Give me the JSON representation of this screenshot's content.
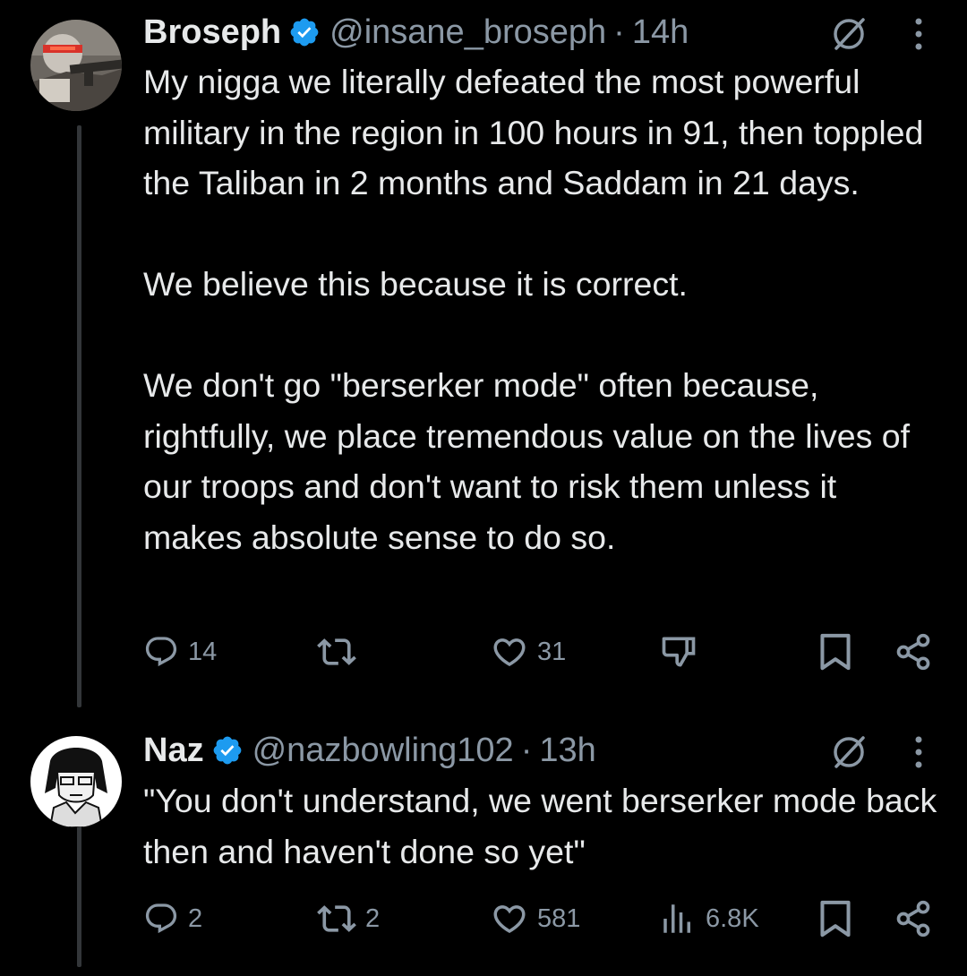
{
  "tweets": [
    {
      "author_name": "Broseph",
      "handle": "@insane_broseph",
      "separator": "·",
      "time": "14h",
      "paragraphs": [
        "My nigga we literally defeated the most powerful military in the region in 100 hours in 91, then toppled the Taliban in 2 months and Saddam in 21 days.",
        "We believe this because it is correct.",
        "We don't go \"berserker mode\" often because, rightfully, we place tremendous value on the lives of our troops and don't want to risk them unless it makes absolute sense to do so."
      ],
      "replies": "14",
      "reposts": "",
      "likes": "31"
    },
    {
      "author_name": "Naz",
      "handle": "@nazbowling102",
      "separator": "·",
      "time": "13h",
      "paragraphs": [
        "\"You don't understand, we went berserker mode back then and haven't done so yet\""
      ],
      "replies": "2",
      "reposts": "2",
      "likes": "581",
      "views": "6.8K"
    }
  ],
  "icons": {
    "verified": "verified-badge-icon",
    "grok": "grok-icon",
    "more": "more-options-icon",
    "reply": "reply-icon",
    "repost": "repost-icon",
    "like": "heart-icon",
    "downvote": "downvote-icon",
    "views": "views-icon",
    "bookmark": "bookmark-icon",
    "share": "share-icon"
  },
  "colors": {
    "background": "#000000",
    "text": "#e7e9ea",
    "secondary": "#8b98a5",
    "verified": "#1d9bf0",
    "thread_line": "#333639"
  }
}
